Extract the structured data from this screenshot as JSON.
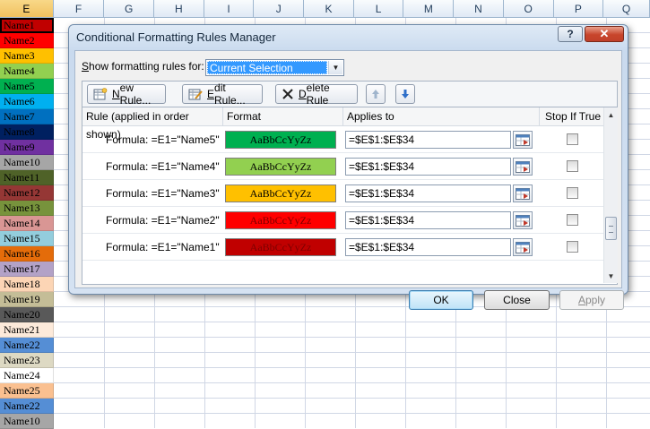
{
  "sheet": {
    "columns": [
      {
        "label": "E",
        "w": 60,
        "selected": true
      },
      {
        "label": "F",
        "w": 57
      },
      {
        "label": "G",
        "w": 56
      },
      {
        "label": "H",
        "w": 56
      },
      {
        "label": "I",
        "w": 56
      },
      {
        "label": "J",
        "w": 56
      },
      {
        "label": "K",
        "w": 56
      },
      {
        "label": "L",
        "w": 56
      },
      {
        "label": "M",
        "w": 56
      },
      {
        "label": "N",
        "w": 56
      },
      {
        "label": "O",
        "w": 56
      },
      {
        "label": "P",
        "w": 56
      },
      {
        "label": "Q",
        "w": 52
      }
    ],
    "cells": [
      {
        "text": "Name1",
        "bg": "#c00000",
        "active": true
      },
      {
        "text": "Name2",
        "bg": "#ff0000"
      },
      {
        "text": "Name3",
        "bg": "#ffc000"
      },
      {
        "text": "Name4",
        "bg": "#92d050"
      },
      {
        "text": "Name5",
        "bg": "#00b050"
      },
      {
        "text": "Name6",
        "bg": "#00b0f0"
      },
      {
        "text": "Name7",
        "bg": "#0070c0"
      },
      {
        "text": "Name8",
        "bg": "#002060"
      },
      {
        "text": "Name9",
        "bg": "#7030a0"
      },
      {
        "text": "Name10",
        "bg": "#a6a6a6"
      },
      {
        "text": "Name11",
        "bg": "#4f6228"
      },
      {
        "text": "Name12",
        "bg": "#953735"
      },
      {
        "text": "Name13",
        "bg": "#77933c"
      },
      {
        "text": "Name14",
        "bg": "#d99694"
      },
      {
        "text": "Name15",
        "bg": "#93cddd"
      },
      {
        "text": "Name16",
        "bg": "#e46c0a"
      },
      {
        "text": "Name17",
        "bg": "#b3a2c7"
      },
      {
        "text": "Name18",
        "bg": "#fcd5b5"
      },
      {
        "text": "Name19",
        "bg": "#c4bd97"
      },
      {
        "text": "Name20",
        "bg": "#595959"
      },
      {
        "text": "Name21",
        "bg": "#fdeada"
      },
      {
        "text": "Name22",
        "bg": "#558ed5"
      },
      {
        "text": "Name23",
        "bg": "#ddd9c3"
      },
      {
        "text": "Name24",
        "bg": "#ffffff"
      },
      {
        "text": "Name25",
        "bg": "#fac090"
      },
      {
        "text": "Name22",
        "bg": "#558ed5"
      },
      {
        "text": "Name10",
        "bg": "#a6a6a6"
      }
    ]
  },
  "dialog": {
    "title": "Conditional Formatting Rules Manager",
    "help_label": "?",
    "close_label": "✕",
    "show_label_pre": "",
    "show_label_key": "S",
    "show_label_post": "how formatting rules for:",
    "show_value": "Current Selection",
    "toolbar": {
      "new_key": "N",
      "new_rest": "ew Rule...",
      "edit_key": "E",
      "edit_rest": "dit Rule...",
      "delete_key": "D",
      "delete_rest": "elete Rule"
    },
    "headers": {
      "rule": "Rule (applied in order shown)",
      "format": "Format",
      "applies": "Applies to",
      "stop": "Stop If True"
    },
    "rules": [
      {
        "formula": "Formula: =E1=\"Name5\"",
        "preview": "AaBbCcYyZz",
        "fill": "#00b050",
        "text": "#000000",
        "applies": "=$E$1:$E$34",
        "stop": false
      },
      {
        "formula": "Formula: =E1=\"Name4\"",
        "preview": "AaBbCcYyZz",
        "fill": "#92d050",
        "text": "#000000",
        "applies": "=$E$1:$E$34",
        "stop": false
      },
      {
        "formula": "Formula: =E1=\"Name3\"",
        "preview": "AaBbCcYyZz",
        "fill": "#ffc000",
        "text": "#000000",
        "applies": "=$E$1:$E$34",
        "stop": false
      },
      {
        "formula": "Formula: =E1=\"Name2\"",
        "preview": "AaBbCcYyZz",
        "fill": "#ff0000",
        "text": "#7f0000",
        "applies": "=$E$1:$E$34",
        "stop": false
      },
      {
        "formula": "Formula: =E1=\"Name1\"",
        "preview": "AaBbCcYyZz",
        "fill": "#c00000",
        "text": "#7f0000",
        "applies": "=$E$1:$E$34",
        "stop": false
      }
    ],
    "ok_label": "OK",
    "close_btn_label": "Close",
    "apply_key": "A",
    "apply_rest": "pply"
  }
}
